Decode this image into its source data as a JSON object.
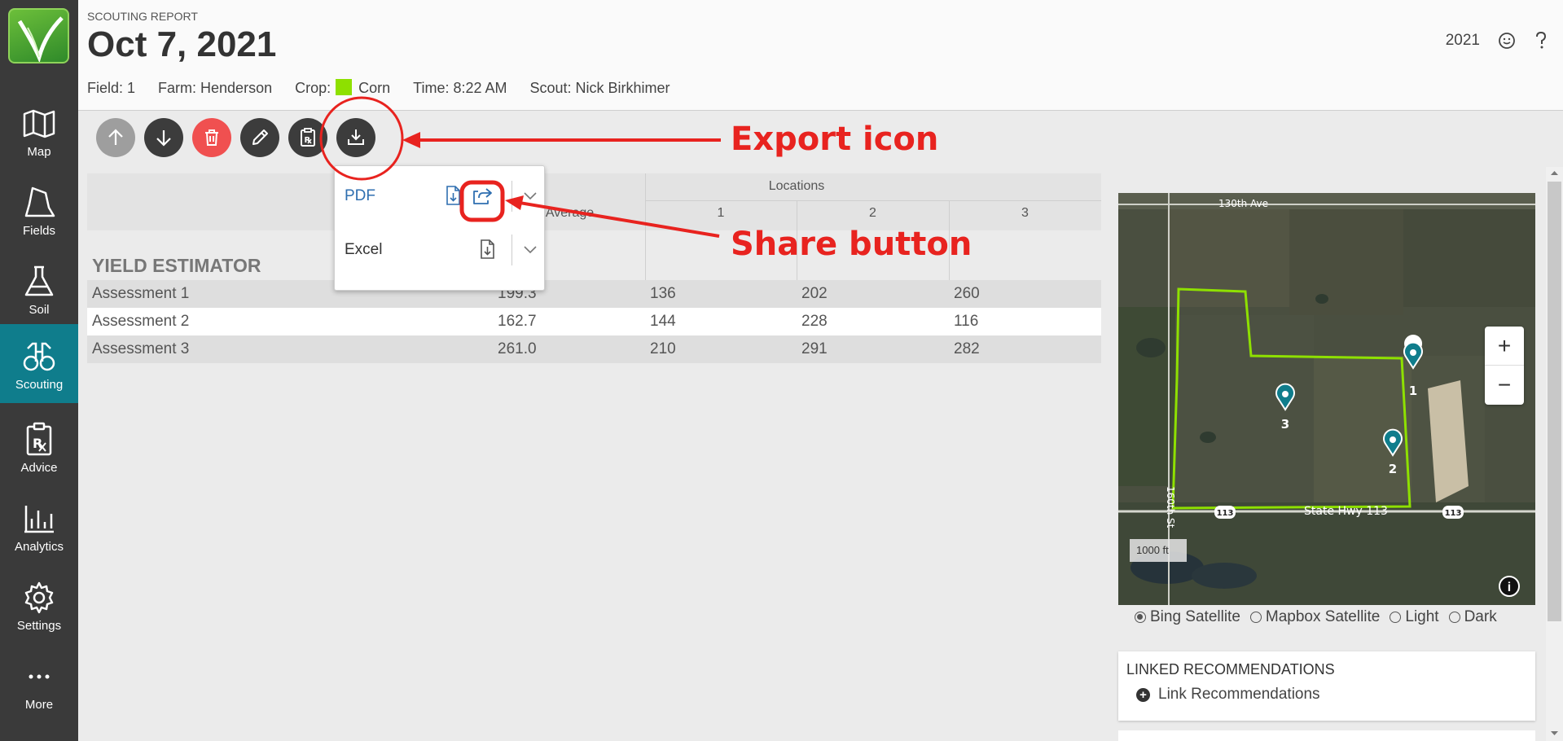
{
  "nav": [
    {
      "label": "Map",
      "icon": "map-icon"
    },
    {
      "label": "Fields",
      "icon": "fields-icon"
    },
    {
      "label": "Soil",
      "icon": "flask-icon"
    },
    {
      "label": "Scouting",
      "icon": "binoculars-icon",
      "active": true
    },
    {
      "label": "Advice",
      "icon": "prescription-icon"
    },
    {
      "label": "Analytics",
      "icon": "bar-chart-icon"
    },
    {
      "label": "Settings",
      "icon": "gear-icon"
    },
    {
      "label": "More",
      "icon": "more-icon"
    }
  ],
  "header": {
    "subtitle": "SCOUTING REPORT",
    "title": "Oct 7, 2021",
    "field": "Field: 1",
    "farm": "Farm: Henderson",
    "crop_label": "Crop:",
    "crop": "Corn",
    "crop_color": "#8ee000",
    "time": "Time: 8:22 AM",
    "scout": "Scout: Nick Birkhimer",
    "year": "2021"
  },
  "toolbar": [
    "arrow-up-icon",
    "arrow-down-icon",
    "trash-icon",
    "pencil-icon",
    "clipboard-rx-icon",
    "export-icon"
  ],
  "table": {
    "locations_label": "Locations",
    "average_label": "Average",
    "columns": [
      "1",
      "2",
      "3"
    ],
    "section": "YIELD ESTIMATOR",
    "rows": [
      {
        "name": "Assessment 1",
        "avg": "199.3",
        "vals": [
          "136",
          "202",
          "260"
        ]
      },
      {
        "name": "Assessment 2",
        "avg": "162.7",
        "vals": [
          "144",
          "228",
          "116"
        ]
      },
      {
        "name": "Assessment 3",
        "avg": "261.0",
        "vals": [
          "210",
          "291",
          "282"
        ]
      }
    ]
  },
  "export_menu": {
    "pdf": "PDF",
    "excel": "Excel"
  },
  "map": {
    "road_north": "130th Ave",
    "road_south": "State Hwy 113",
    "road_west": "160th St",
    "shield": "113",
    "scale": "1000 ft",
    "pins": [
      "1",
      "2",
      "3"
    ],
    "zoom_in": "+",
    "zoom_out": "−",
    "info": "i",
    "layers": [
      "Bing Satellite",
      "Mapbox Satellite",
      "Light",
      "Dark"
    ]
  },
  "linked": {
    "title": "LINKED RECOMMENDATIONS",
    "link": "Link Recommendations"
  },
  "annotations": {
    "export": "Export icon",
    "share": "Share button"
  }
}
